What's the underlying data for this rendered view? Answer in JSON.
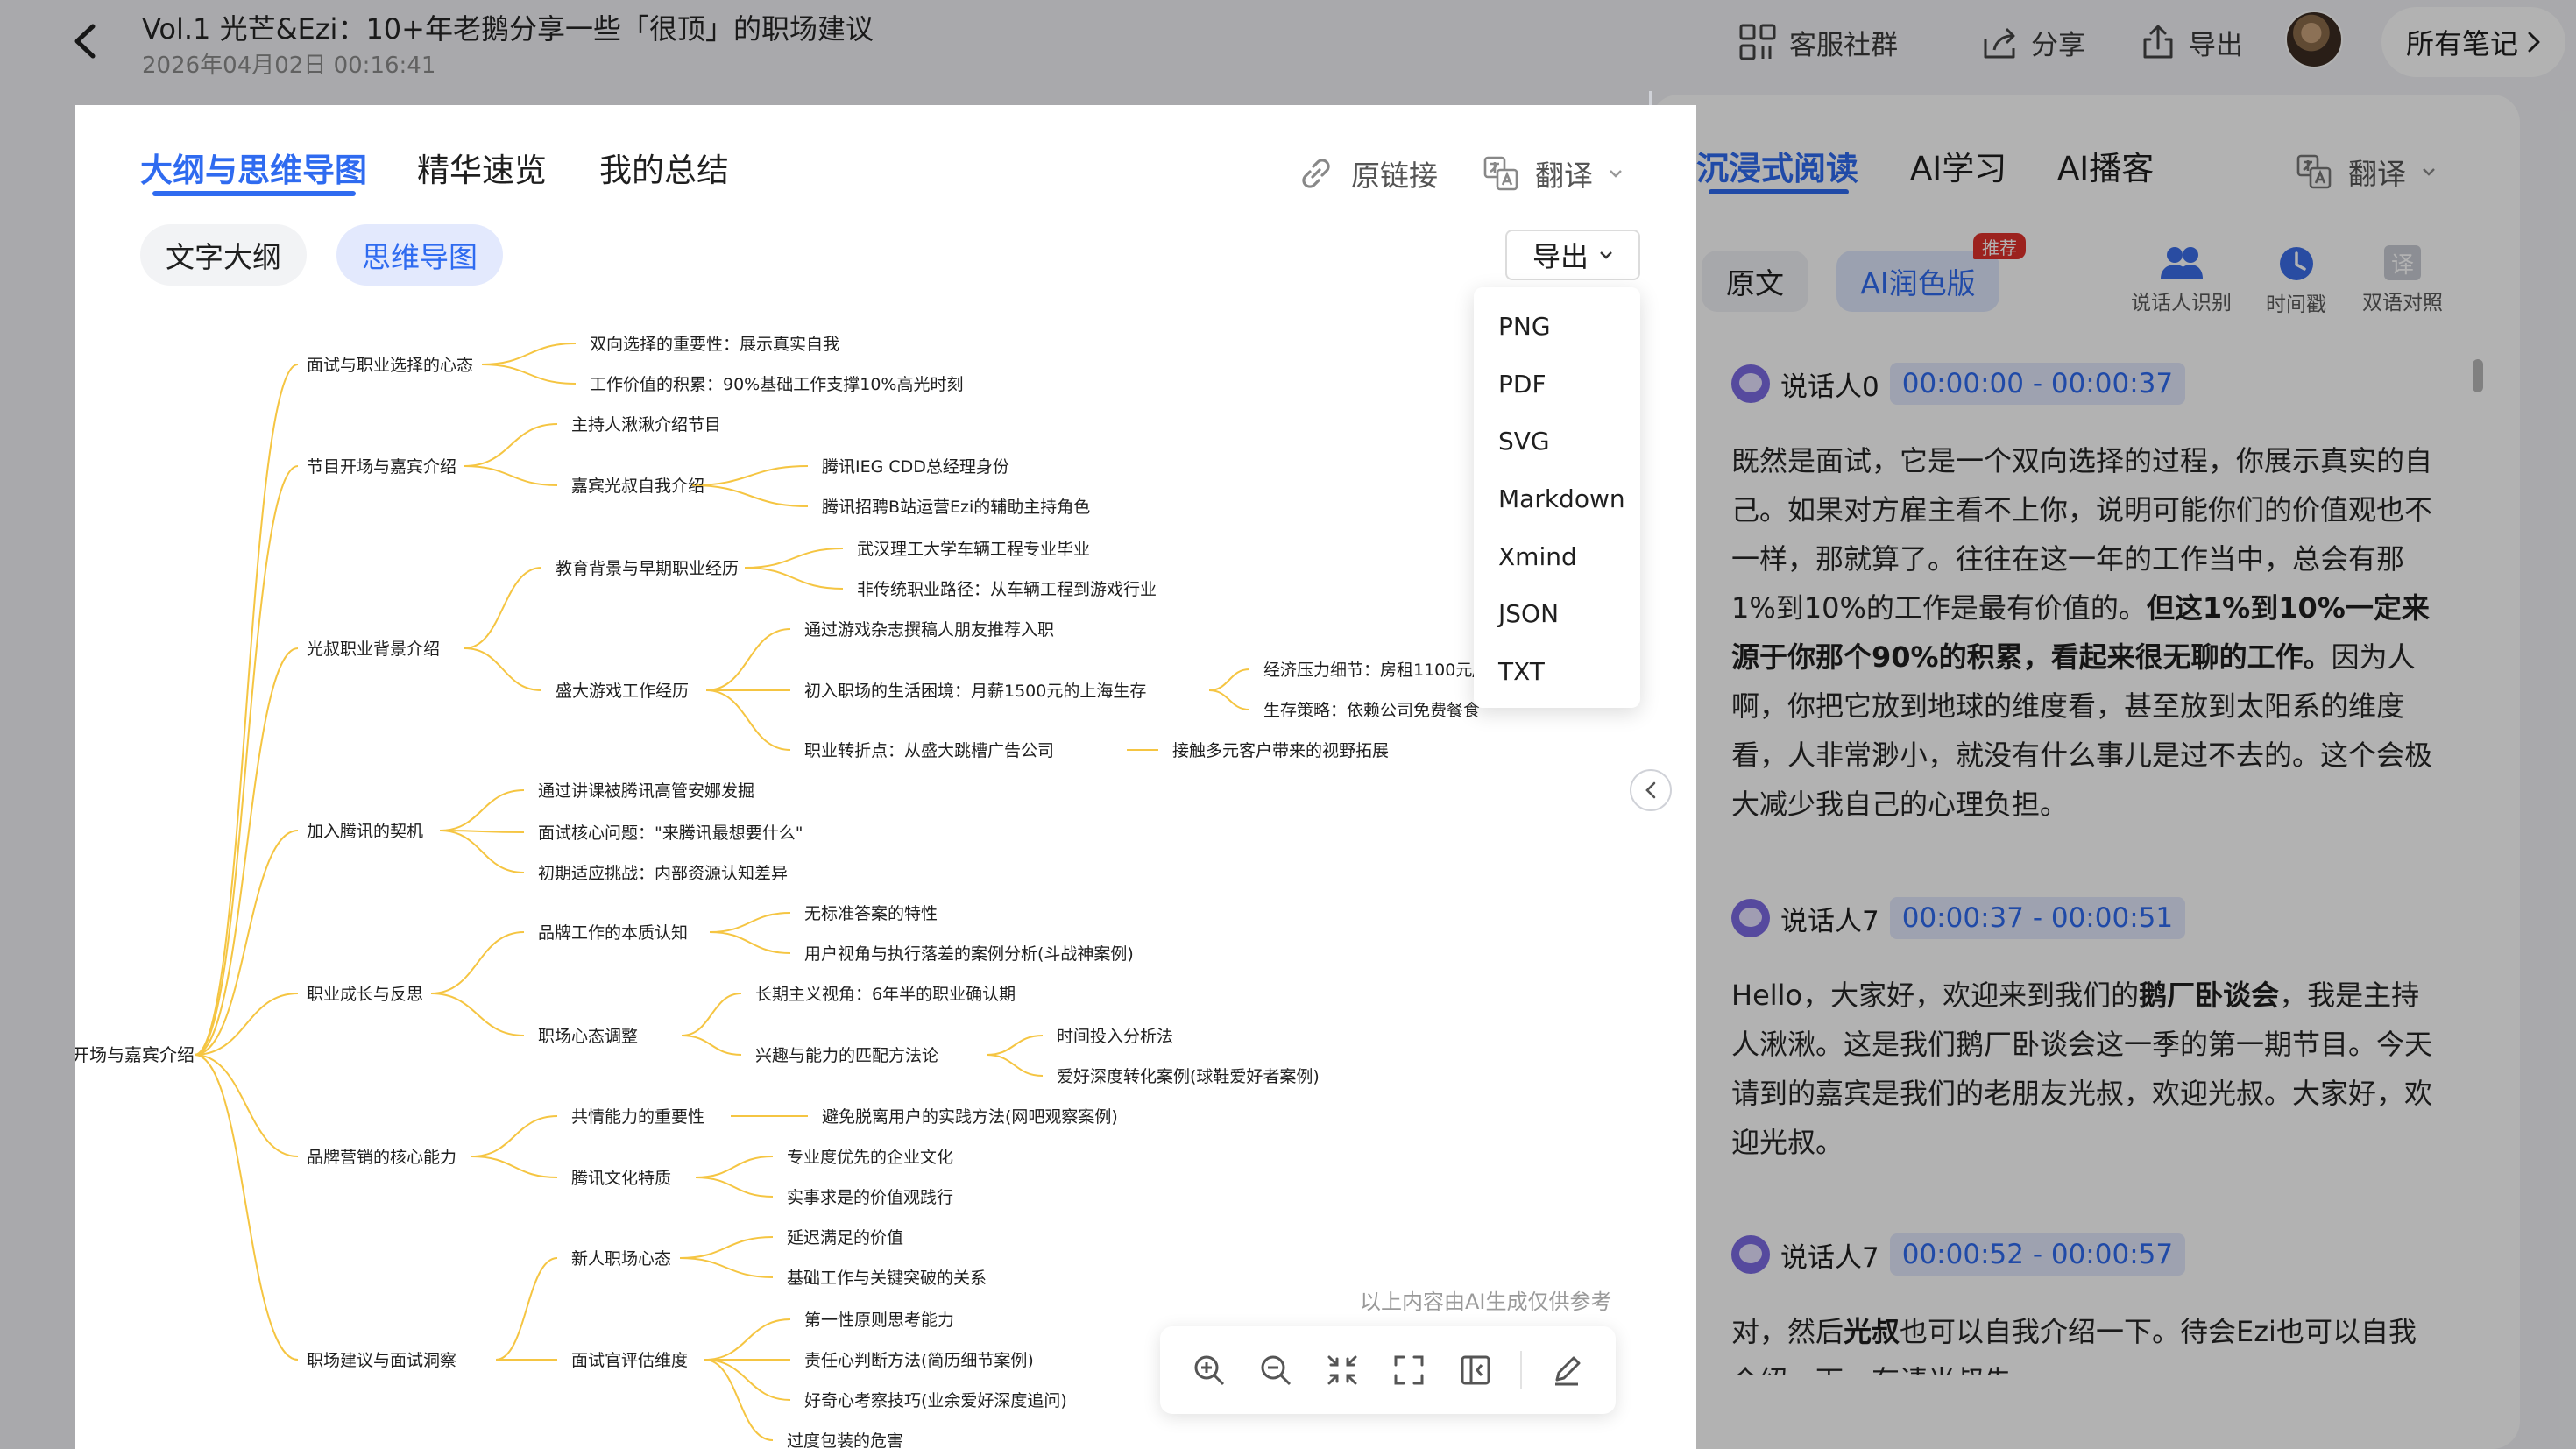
{
  "header": {
    "title": "Vol.1 光芒&Ezi：10+年老鹅分享一些「很顶」的职场建议",
    "timestamp": "2026年04月02日 00:16:41",
    "community_label": "客服社群",
    "share_label": "分享",
    "export_label": "导出",
    "all_notes_label": "所有笔记"
  },
  "left_panel": {
    "tabs": [
      "大纲与思维导图",
      "精华速览",
      "我的总结"
    ],
    "active_tab": 0,
    "source_link_label": "原链接",
    "translate_label": "翻译",
    "view_toggles": [
      "文字大纲",
      "思维导图"
    ],
    "active_view": 1,
    "export_button_label": "导出",
    "export_menu": [
      "PNG",
      "PDF",
      "SVG",
      "Markdown",
      "Xmind",
      "JSON",
      "TXT"
    ],
    "disclaimer": "以上内容由AI生成仅供参考",
    "zoom_tools": [
      "zoom-in-icon",
      "zoom-out-icon",
      "shrink-icon",
      "fullscreen-icon",
      "sidebar-toggle-icon",
      "edit-icon"
    ]
  },
  "mindmap": {
    "root": "开场与嘉宾介绍",
    "l1": [
      "面试与职业选择的心态",
      "节目开场与嘉宾介绍",
      "光叔职业背景介绍",
      "加入腾讯的契机",
      "职业成长与反思",
      "品牌营销的核心能力",
      "职场建议与面试洞察"
    ],
    "l2": [
      "双向选择的重要性：展示真实自我",
      "工作价值的积累：90%基础工作支撑10%高光时刻",
      "主持人湫湫介绍节目",
      "嘉宾光叔自我介绍",
      "教育背景与早期职业经历",
      "盛大游戏工作经历",
      "通过讲课被腾讯高管安娜发掘",
      "面试核心问题：\"来腾讯最想要什么\"",
      "初期适应挑战：内部资源认知差异",
      "品牌工作的本质认知",
      "职场心态调整",
      "共情能力的重要性",
      "腾讯文化特质",
      "新人职场心态",
      "面试官评估维度"
    ],
    "l3": [
      "腾讯IEG CDD总经理身份",
      "腾讯招聘B站运营Ezi的辅助主持角色",
      "武汉理工大学车辆工程专业毕业",
      "非传统职业路径：从车辆工程到游戏行业",
      "通过游戏杂志撰稿人朋友推荐入职",
      "初入职场的生活困境：月薪1500元的上海生存",
      "职业转折点：从盛大跳槽广告公司",
      "无标准答案的特性",
      "用户视角与执行落差的案例分析(斗战神案例)",
      "长期主义视角：6年半的职业确认期",
      "兴趣与能力的匹配方法论",
      "避免脱离用户的实践方法(网吧观察案例)",
      "专业度优先的企业文化",
      "实事求是的价值观践行",
      "延迟满足的价值",
      "基础工作与关键突破的关系",
      "第一性原则思考能力",
      "责任心判断方法(简历细节案例)",
      "好奇心考察技巧(业余爱好深度追问)",
      "过度包装的危害"
    ],
    "l4": [
      "经济压力细节：房租1100元/",
      "生存策略：依赖公司免费餐食",
      "接触多元客户带来的视野拓展",
      "时间投入分析法",
      "爱好深度转化案例(球鞋爱好者案例)"
    ]
  },
  "right_panel": {
    "tabs": [
      "沉浸式阅读",
      "AI学习",
      "AI播客"
    ],
    "active_tab": 0,
    "translate_label": "翻译",
    "segments": [
      "原文",
      "AI润色版"
    ],
    "recommend_badge": "推荐",
    "tools": [
      "说话人识别",
      "时间戳",
      "双语对照"
    ],
    "bilingual_glyph": "译",
    "transcript": [
      {
        "speaker": "说话人0",
        "time": "00:00:00 - 00:00:37",
        "parts": [
          {
            "t": "既然是面试，它是一个双向选择的过程，你展示真实的自己。如果对方雇主看不上你，说明可能你们的价值观也不一样，那就算了。往往在这一年的工作当中，总会有那1%到10%的工作是最有价值的。",
            "b": false
          },
          {
            "t": "但这1%到10%一定来源于你那个90%的积累，看起来很无聊的工作。",
            "b": true
          },
          {
            "t": "因为人啊，你把它放到地球的维度看，甚至放到太阳系的维度看，人非常渺小，就没有什么事儿是过不去的。这个会极大减少我自己的心理负担。",
            "b": false
          }
        ]
      },
      {
        "speaker": "说话人7",
        "time": "00:00:37 - 00:00:51",
        "parts": [
          {
            "t": "Hello，大家好，欢迎来到我们的",
            "b": false
          },
          {
            "t": "鹅厂卧谈会",
            "b": true
          },
          {
            "t": "，我是主持人湫湫。这是我们鹅厂卧谈会这一季的第一期节目。今天请到的嘉宾是我们的老朋友光叔，欢迎光叔。大家好，欢迎光叔。",
            "b": false
          }
        ]
      },
      {
        "speaker": "说话人7",
        "time": "00:00:52 - 00:00:57",
        "parts": [
          {
            "t": "对，然后",
            "b": false
          },
          {
            "t": "光叔",
            "b": true
          },
          {
            "t": "也可以自我介绍一下。待会Ezi也可以自我介绍一下，有请光叔先。",
            "b": false
          }
        ]
      }
    ]
  },
  "colors": {
    "accent": "#2f6bf0",
    "mindmap_line": "#f5c542",
    "badge": "#e0322b"
  }
}
